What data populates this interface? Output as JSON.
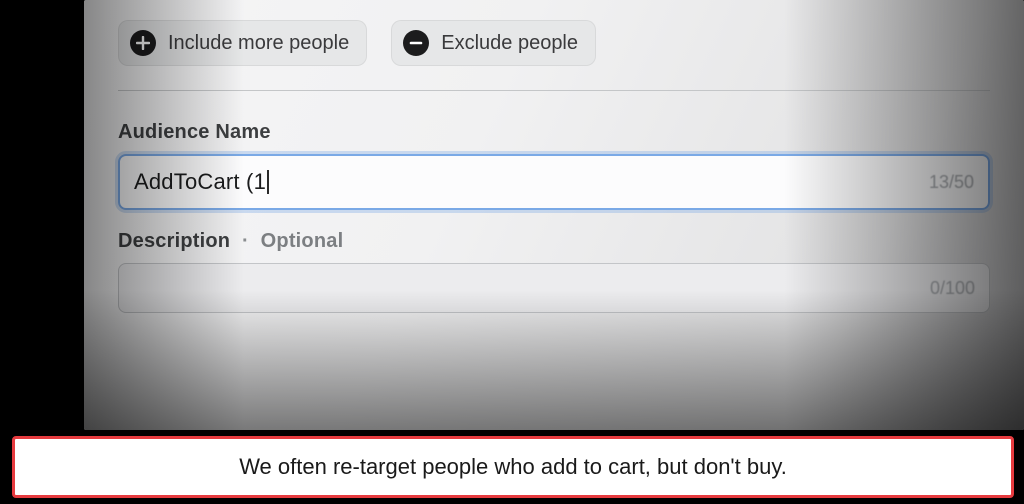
{
  "buttons": {
    "include_label": "Include more people",
    "exclude_label": "Exclude people"
  },
  "audience_name": {
    "label": "Audience Name",
    "value": "AddToCart (1",
    "counter": "13/50"
  },
  "description": {
    "label": "Description",
    "separator": "·",
    "optional": "Optional",
    "value": "",
    "counter": "0/100"
  },
  "caption": "We often re-target people who add to cart, but don't buy."
}
